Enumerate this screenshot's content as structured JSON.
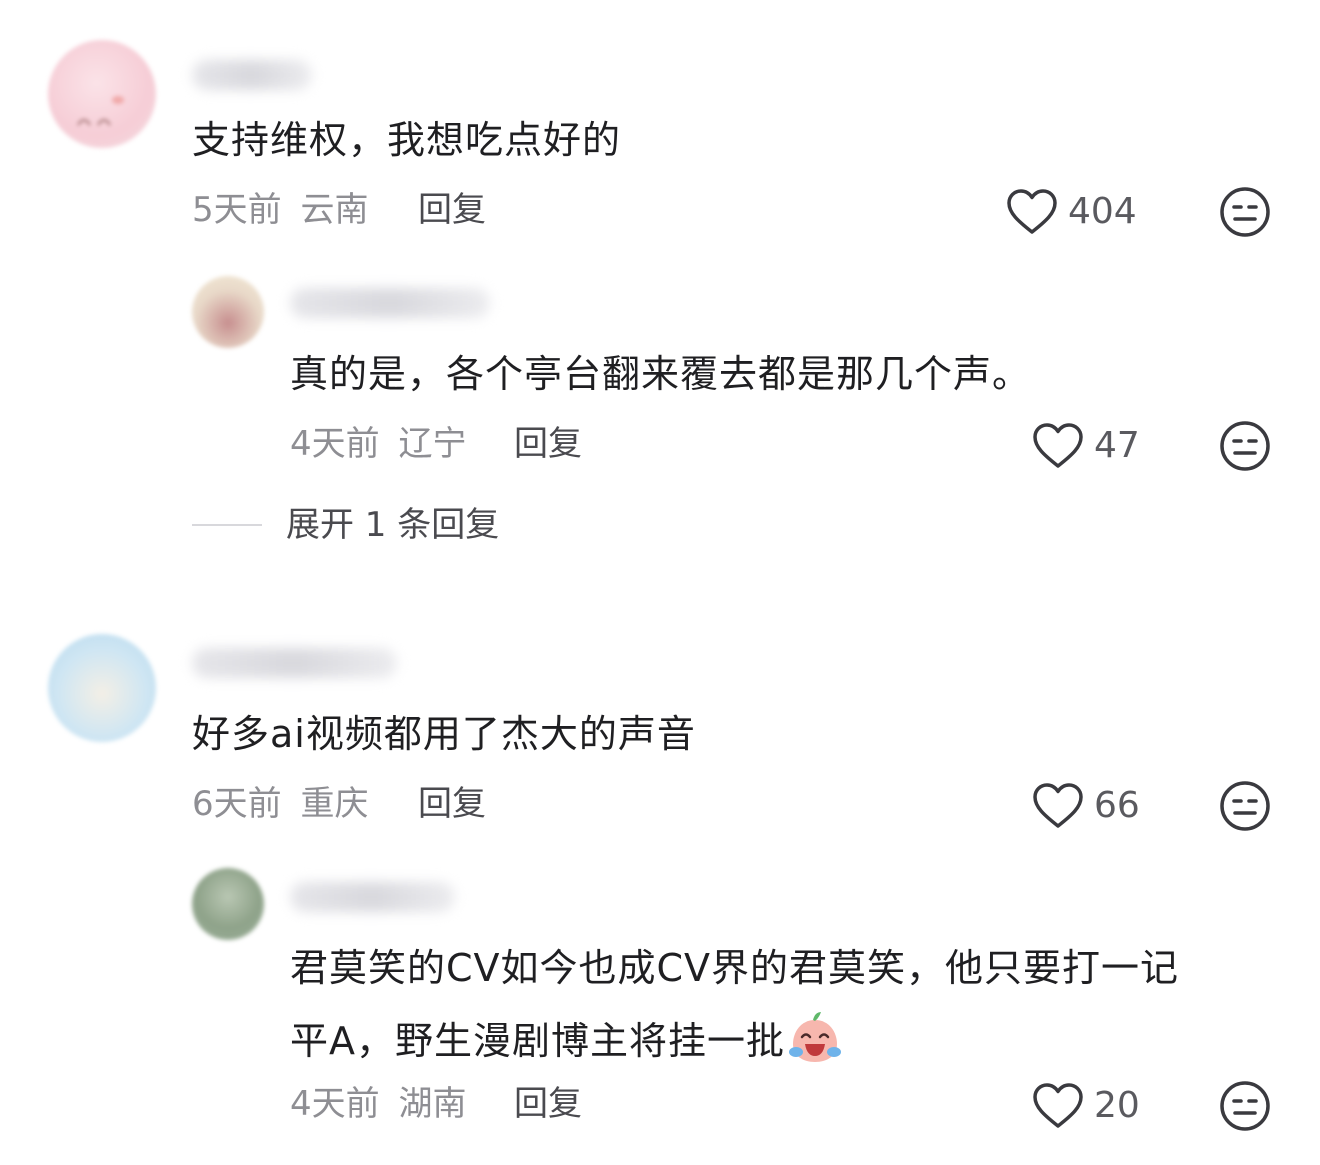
{
  "comments": [
    {
      "content": "支持维权，我想吃点好的",
      "time": "5天前",
      "location": "云南",
      "reply_label": "回复",
      "likes": "404"
    },
    {
      "content": "真的是，各个亭台翻来覆去都是那几个声。",
      "time": "4天前",
      "location": "辽宁",
      "reply_label": "回复",
      "likes": "47",
      "expand_label": "展开 1 条回复"
    },
    {
      "content": "好多ai视频都用了杰大的声音",
      "time": "6天前",
      "location": "重庆",
      "reply_label": "回复",
      "likes": "66"
    },
    {
      "content_line1": "君莫笑的CV如今也成CV界的君莫笑，他只要打一记",
      "content_line2": "平A，野生漫剧博主将挂一批",
      "time": "4天前",
      "location": "湖南",
      "reply_label": "回复",
      "likes": "20",
      "emoji": "laughing-crying-emoji"
    }
  ],
  "icons": {
    "like": "heart-outline-icon",
    "dislike": "neutral-face-icon"
  },
  "colors": {
    "text": "#1f1f22",
    "meta": "#8e8e93",
    "icon": "#3a3a3f"
  }
}
